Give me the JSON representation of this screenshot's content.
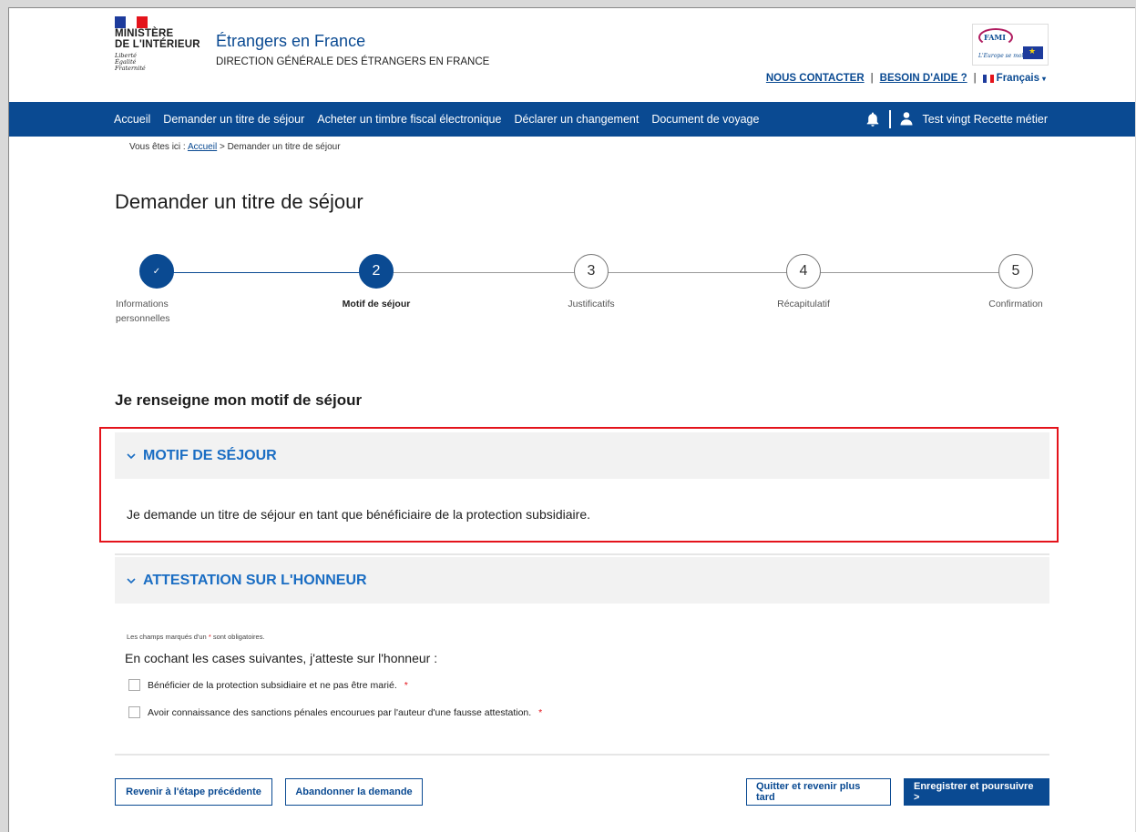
{
  "header": {
    "logo": {
      "line1": "MINISTÈRE",
      "line2": "DE L'INTÉRIEUR",
      "motto": [
        "Liberté",
        "Égalité",
        "Fraternité"
      ]
    },
    "site_title": "Étrangers en France",
    "site_subtitle": "DIRECTION GÉNÉRALE DES ÉTRANGERS EN FRANCE",
    "partner_logo": {
      "text": "FAMI",
      "slogan": "L'Europe se mobilise"
    },
    "links": {
      "contact": "NOUS CONTACTER",
      "help": "BESOIN D'AIDE ?",
      "separator": "|",
      "language": "Français"
    }
  },
  "nav": {
    "items": [
      "Accueil",
      "Demander un titre de séjour",
      "Acheter un timbre fiscal électronique",
      "Déclarer un changement",
      "Document de voyage"
    ],
    "user": "Test vingt Recette métier"
  },
  "breadcrumb": {
    "prefix": "Vous êtes ici :",
    "home": "Accueil",
    "current": "> Demander un titre de séjour"
  },
  "page_title": "Demander un titre de séjour",
  "stepper": {
    "current_step": 2,
    "steps": [
      {
        "number": "✓",
        "label": "Informations personnelles",
        "status": "done"
      },
      {
        "number": "2",
        "label": "Motif de séjour",
        "status": "active"
      },
      {
        "number": "3",
        "label": "Justificatifs",
        "status": "todo"
      },
      {
        "number": "4",
        "label": "Récapitulatif",
        "status": "todo"
      },
      {
        "number": "5",
        "label": "Confirmation",
        "status": "todo"
      }
    ]
  },
  "section_heading": "Je renseigne mon motif de séjour",
  "motif": {
    "title": "MOTIF DE SÉJOUR",
    "text": "Je demande un titre de séjour en tant que bénéficiaire de la protection subsidiaire."
  },
  "attestation": {
    "title": "ATTESTATION SUR L'HONNEUR",
    "note_prefix": "Les champs marqués d'un",
    "note_star": "*",
    "note_suffix": "sont obligatoires.",
    "lead": "En cochant les cases suivantes, j'atteste sur l'honneur :",
    "checkboxes": [
      {
        "label": "Bénéficier de la protection subsidiaire et ne pas être marié.",
        "checked": false
      },
      {
        "label": "Avoir connaissance des sanctions pénales encourues par l'auteur d'une fausse attestation.",
        "checked": false
      }
    ],
    "required_mark": "*"
  },
  "buttons": {
    "previous": "Revenir à l'étape précédente",
    "abandon": "Abandonner la demande",
    "later": "Quitter et revenir plus tard",
    "save": "Enregistrer et poursuivre >"
  },
  "colors": {
    "primary": "#0a4a92",
    "accordion_title": "#1a6dc3",
    "highlight": "#e4131b"
  }
}
